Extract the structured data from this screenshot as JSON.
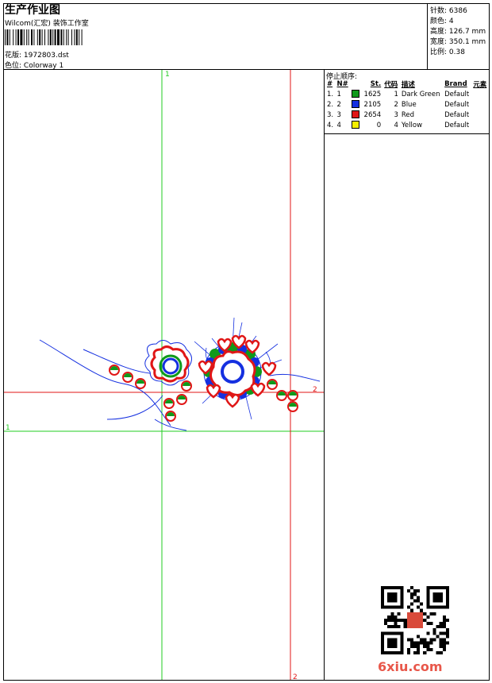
{
  "header": {
    "title": "生产作业图",
    "company": "Wilcom(汇宏) 装饰工作室",
    "design_label": "花版:",
    "design_file": "1972803.dst",
    "colorway_label": "色位:",
    "colorway": "Colorway 1"
  },
  "info": {
    "stitches_label": "针数:",
    "stitches": "6386",
    "colors_label": "颜色:",
    "colors": "4",
    "height_label": "高度:",
    "height": "126.7 mm",
    "width_label": "宽度:",
    "width": "350.1 mm",
    "scale_label": "比例:",
    "scale": "0.38"
  },
  "stop_sequence": {
    "title": "停止顺序:",
    "columns": [
      "#",
      "N#",
      "St.",
      "代码",
      "描述",
      "Brand",
      "元素"
    ],
    "rows": [
      {
        "idx": "1.",
        "n": "1",
        "color": "#0f9a1b",
        "st": "1625",
        "code": "1",
        "desc": "Dark Green",
        "brand": "Default"
      },
      {
        "idx": "2.",
        "n": "2",
        "color": "#1530e0",
        "st": "2105",
        "code": "2",
        "desc": "Blue",
        "brand": "Default"
      },
      {
        "idx": "3.",
        "n": "3",
        "color": "#e01616",
        "st": "2654",
        "code": "3",
        "desc": "Red",
        "brand": "Default"
      },
      {
        "idx": "4.",
        "n": "4",
        "color": "#f5f000",
        "st": "0",
        "code": "4",
        "desc": "Yellow",
        "brand": "Default"
      }
    ]
  },
  "guides": {
    "green_label": "1",
    "red_label": "2"
  },
  "watermark": {
    "text": "6xiu.com"
  }
}
